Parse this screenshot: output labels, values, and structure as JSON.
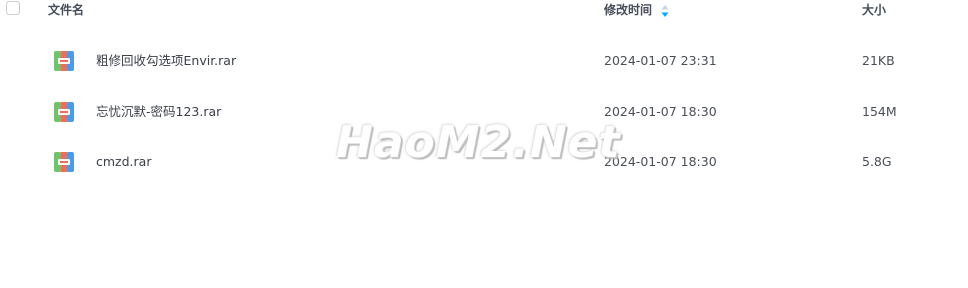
{
  "header": {
    "name_label": "文件名",
    "time_label": "修改时间",
    "size_label": "大小",
    "sort_icon": "sort-arrows-icon"
  },
  "files": [
    {
      "name": "粗修回收勾选项Envir.rar",
      "modified": "2024-01-07 23:31",
      "size": "21KB",
      "icon": "rar-archive-icon"
    },
    {
      "name": "忘忧沉默-密码123.rar",
      "modified": "2024-01-07 18:30",
      "size": "154M",
      "icon": "rar-archive-icon"
    },
    {
      "name": "cmzd.rar",
      "modified": "2024-01-07 18:30",
      "size": "5.8G",
      "icon": "rar-archive-icon"
    }
  ],
  "watermark": "HaoM2.Net",
  "colors": {
    "header_text": "#454d5a",
    "row_text": "#3a3f48",
    "sort_accent": "#06a7ff"
  }
}
